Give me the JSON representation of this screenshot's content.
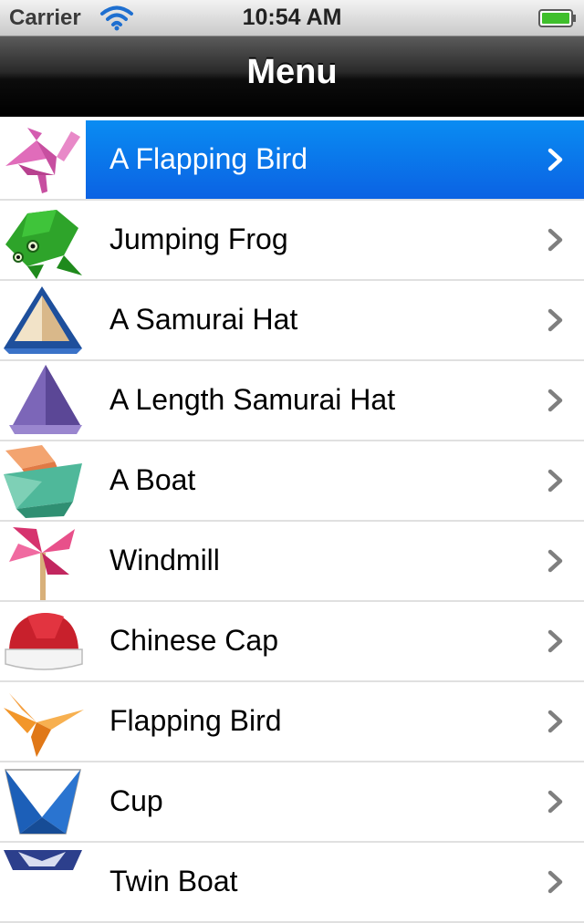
{
  "status_bar": {
    "carrier": "Carrier",
    "time": "10:54 AM",
    "wifi_icon": "wifi-icon",
    "battery_icon": "battery-icon"
  },
  "nav_bar": {
    "title": "Menu"
  },
  "colors": {
    "selected_row": "#0b6fe8",
    "chevron": "#7f7f7f",
    "chevron_selected": "#ffffff"
  },
  "menu": {
    "items": [
      {
        "label": "A Flapping Bird",
        "selected": true,
        "icon": "pink-origami-bird-icon"
      },
      {
        "label": "Jumping Frog",
        "selected": false,
        "icon": "green-origami-frog-icon"
      },
      {
        "label": "A Samurai Hat",
        "selected": false,
        "icon": "origami-samurai-hat-icon"
      },
      {
        "label": "A Length Samurai Hat",
        "selected": false,
        "icon": "purple-origami-tall-hat-icon"
      },
      {
        "label": "A Boat",
        "selected": false,
        "icon": "origami-boat-icon"
      },
      {
        "label": "Windmill",
        "selected": false,
        "icon": "origami-windmill-icon"
      },
      {
        "label": "Chinese Cap",
        "selected": false,
        "icon": "red-origami-cap-icon"
      },
      {
        "label": "Flapping Bird",
        "selected": false,
        "icon": "orange-origami-bird-icon"
      },
      {
        "label": "Cup",
        "selected": false,
        "icon": "blue-origami-cup-icon"
      },
      {
        "label": "Twin Boat",
        "selected": false,
        "icon": "origami-twin-boat-icon"
      }
    ]
  }
}
